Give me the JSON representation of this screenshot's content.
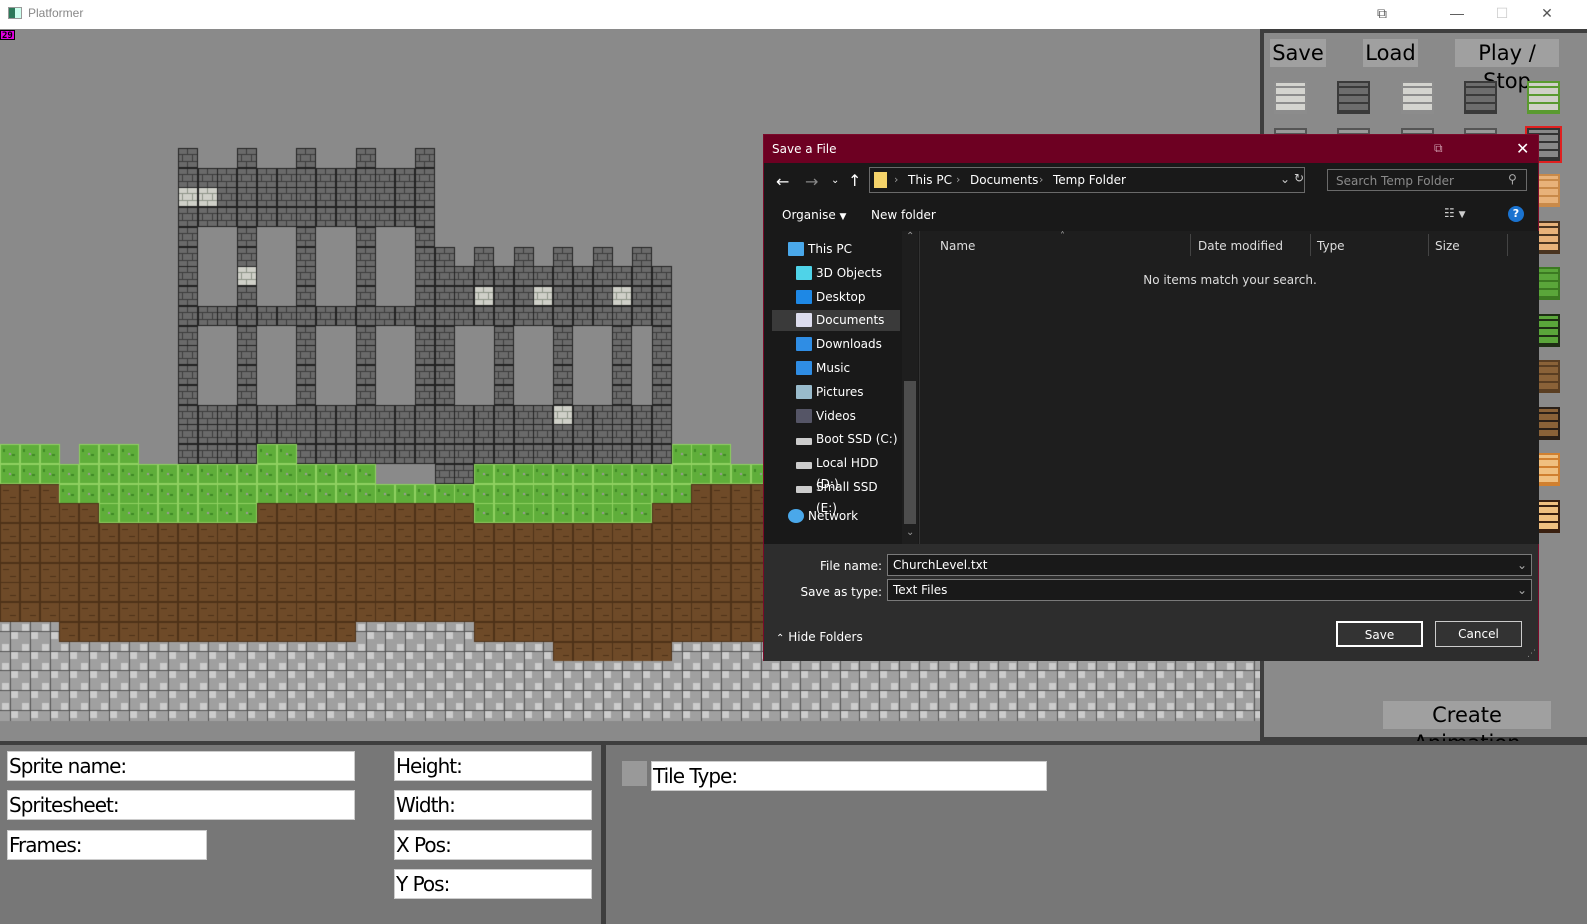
{
  "window": {
    "title": "Platformer",
    "fps": "29"
  },
  "toolbar": {
    "save_label": "Save",
    "load_label": "Load",
    "play_label": "Play / Stop",
    "create_animation_label": "Create Animation"
  },
  "palette": {
    "tiles": [
      "stone-brick-light",
      "stone-brick-dark",
      "stone-brick-light",
      "stone-brick-dark",
      "stone-brick-mossy",
      "stone-brick-broken",
      "stone-brick-broken",
      "stone-brick-broken",
      "stone-brick-broken",
      "stone-brick-cracked",
      "sand",
      "sand-broken",
      "grass",
      "grass-broken",
      "dirt",
      "dirt-broken",
      "sandstone-brick",
      "sandstone-broken"
    ],
    "selected_index": 9,
    "selected_color": "#e02020"
  },
  "properties": {
    "sprite_name": "Sprite name:",
    "spritesheet": "Spritesheet:",
    "frames": "Frames:",
    "height": "Height:",
    "width": "Width:",
    "x_pos": "X Pos:",
    "y_pos": "Y Pos:",
    "tile_type": "Tile Type:"
  },
  "dialog": {
    "title": "Save a File",
    "breadcrumb": [
      "This PC",
      "Documents",
      "Temp Folder"
    ],
    "search_placeholder": "Search Temp Folder",
    "organise_label": "Organise",
    "new_folder_label": "New folder",
    "nav": [
      {
        "label": "This PC",
        "icon": "computer-icon"
      },
      {
        "label": "3D Objects",
        "icon": "cube-icon"
      },
      {
        "label": "Desktop",
        "icon": "desktop-icon"
      },
      {
        "label": "Documents",
        "icon": "document-icon",
        "selected": true
      },
      {
        "label": "Downloads",
        "icon": "download-icon"
      },
      {
        "label": "Music",
        "icon": "music-icon"
      },
      {
        "label": "Pictures",
        "icon": "picture-icon"
      },
      {
        "label": "Videos",
        "icon": "video-icon"
      },
      {
        "label": "Boot SSD (C:)",
        "icon": "drive-icon"
      },
      {
        "label": "Local HDD (D:)",
        "icon": "drive-icon"
      },
      {
        "label": "Small SSD (E:)",
        "icon": "drive-icon"
      },
      {
        "label": "Network",
        "icon": "network-icon"
      }
    ],
    "columns": [
      "Name",
      "Date modified",
      "Type",
      "Size"
    ],
    "empty_message": "No items match your search.",
    "file_name_label": "File name:",
    "file_name_value": "ChurchLevel.txt",
    "save_type_label": "Save as type:",
    "save_type_value": "Text Files",
    "hide_folders_label": "Hide Folders",
    "save_label": "Save",
    "cancel_label": "Cancel",
    "accent": "#6d0022"
  }
}
